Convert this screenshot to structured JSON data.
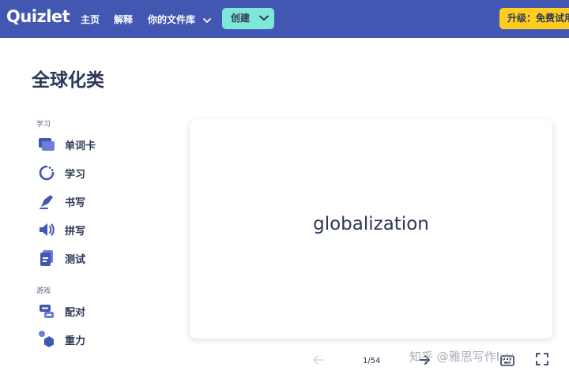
{
  "header": {
    "logo": "Quizlet",
    "nav": {
      "home": "主页",
      "explain": "解释",
      "library": "你的文件库"
    },
    "create_label": "创建",
    "upgrade_label": "升级：免费试用"
  },
  "page": {
    "title": "全球化类"
  },
  "sidebar": {
    "study_label": "学习",
    "study_items": [
      {
        "label": "单词卡",
        "icon": "flashcards-icon"
      },
      {
        "label": "学习",
        "icon": "learn-icon"
      },
      {
        "label": "书写",
        "icon": "write-icon"
      },
      {
        "label": "拼写",
        "icon": "spell-icon"
      },
      {
        "label": "测试",
        "icon": "test-icon"
      }
    ],
    "games_label": "游戏",
    "game_items": [
      {
        "label": "配对",
        "icon": "match-icon"
      },
      {
        "label": "重力",
        "icon": "gravity-icon"
      }
    ]
  },
  "card": {
    "term": "globalization"
  },
  "controls": {
    "counter": "1/54"
  },
  "watermark": "知乎 @雅思写作Ivy",
  "colors": {
    "header_bg": "#4257b2",
    "create_bg": "#7ee7d8",
    "upgrade_bg": "#ffcd1f",
    "icon_primary": "#4257b2",
    "text": "#2e3856"
  }
}
